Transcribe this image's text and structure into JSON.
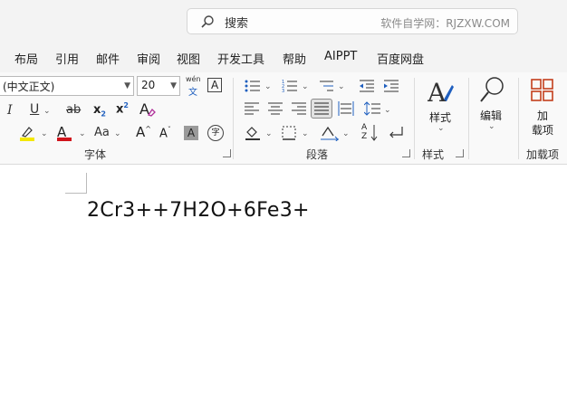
{
  "search": {
    "placeholder": "搜索",
    "watermark": "软件自学网：RJZXW.COM"
  },
  "tabs": [
    {
      "label": "布局"
    },
    {
      "label": "引用"
    },
    {
      "label": "邮件"
    },
    {
      "label": "审阅"
    },
    {
      "label": "视图"
    },
    {
      "label": "开发工具"
    },
    {
      "label": "帮助"
    },
    {
      "label": "AIPPT"
    },
    {
      "label": "百度网盘"
    }
  ],
  "font": {
    "name": "(中文正文)",
    "size": "20",
    "wen_top": "wén",
    "wen_bottom": "文",
    "border_char": "A",
    "italic": "I",
    "underline": "U",
    "strike": "ab",
    "sub": "x",
    "sub_small": "2",
    "sup": "x",
    "sup_small": "2",
    "clear_format": "A",
    "highlight_color": "#f4e800",
    "font_color_letter": "A",
    "font_color": "#d0141c",
    "change_case": "Aa",
    "grow": "A",
    "shrink": "A",
    "shading_char": "A",
    "phonetic_char": "字",
    "group_label": "字体"
  },
  "paragraph": {
    "group_label": "段落",
    "sort_top": "A",
    "sort_bottom": "Z"
  },
  "styles": {
    "button_label": "样式",
    "group_label": "样式"
  },
  "editing": {
    "button_label": "编辑"
  },
  "addins": {
    "button_line1": "加",
    "button_line2": "载项",
    "group_label": "加载项",
    "accent": "#c43e1c"
  },
  "document": {
    "text": "2Cr3++7H2O+6Fe3+"
  }
}
